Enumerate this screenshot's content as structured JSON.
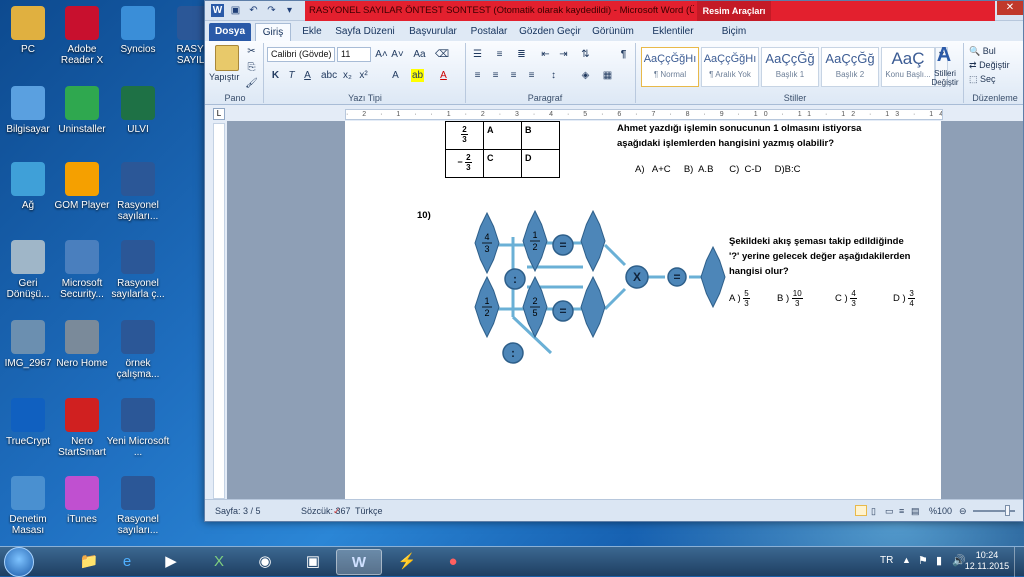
{
  "desktop": {
    "icons": [
      {
        "label": "PC",
        "color": "#e0b040"
      },
      {
        "label": "Adobe Reader X",
        "color": "#c8102e"
      },
      {
        "label": "Syncios",
        "color": "#3a8ed8"
      },
      {
        "label": "RASYO SAYILA",
        "color": "#2b5797"
      },
      {
        "label": "Bilgisayar",
        "color": "#5aa0e0"
      },
      {
        "label": "Uninstaller",
        "color": "#2fa84f"
      },
      {
        "label": "ULVI",
        "color": "#1e7145"
      },
      {
        "label": "Ağ",
        "color": "#3fa0d8"
      },
      {
        "label": "GOM Player",
        "color": "#f5a000"
      },
      {
        "label": "Rasyonel sayıları...",
        "color": "#2b5797"
      },
      {
        "label": "Geri Dönüşü...",
        "color": "#9fb6c8"
      },
      {
        "label": "Microsoft Security...",
        "color": "#4a7fbe"
      },
      {
        "label": "Rasyonel sayılarla ç...",
        "color": "#2b5797"
      },
      {
        "label": "IMG_2967",
        "color": "#6b8fb0"
      },
      {
        "label": "Nero Home",
        "color": "#7a8a9a"
      },
      {
        "label": "örnek çalışma...",
        "color": "#2b5797"
      },
      {
        "label": "TrueCrypt",
        "color": "#1060c0"
      },
      {
        "label": "Nero StartSmart",
        "color": "#d02020"
      },
      {
        "label": "Yeni Microsoft ...",
        "color": "#2b5797"
      },
      {
        "label": "Denetim Masası",
        "color": "#4a90d0"
      },
      {
        "label": "iTunes",
        "color": "#c050d0"
      },
      {
        "label": "Rasyonel sayıları...",
        "color": "#2b5797"
      }
    ]
  },
  "window": {
    "title": "RASYONEL SAYILAR ÖNTEST SONTEST (Otomatik olarak kaydedildi)  -  Microsoft Word (Ürün Et...",
    "context_tab": "Resim Araçları",
    "tabs": [
      "Dosya",
      "Giriş",
      "Ekle",
      "Sayfa Düzeni",
      "Başvurular",
      "Postalar",
      "Gözden Geçir",
      "Görünüm",
      "Eklentiler",
      "Biçim"
    ],
    "active_tab": "Giriş"
  },
  "ribbon": {
    "paste_label": "Yapıştır",
    "clipboard_group": "Pano",
    "font_name": "Calibri (Gövde)",
    "font_size": "11",
    "font_group": "Yazı Tipi",
    "paragraph_group": "Paragraf",
    "styles_group": "Stiller",
    "styles": [
      {
        "preview": "AaÇçĞğHı",
        "name": "¶ Normal"
      },
      {
        "preview": "AaÇçĞğHı",
        "name": "¶ Aralık Yok"
      },
      {
        "preview": "AaÇçĞğ",
        "name": "Başlık 1"
      },
      {
        "preview": "AaÇçĞğ",
        "name": "Başlık 2"
      },
      {
        "preview": "AaÇ",
        "name": "Konu Başlı..."
      }
    ],
    "change_styles": "Stilleri Değiştir",
    "edit_group": "Düzenleme",
    "find": "Bul",
    "replace": "Değiştir",
    "select": "Seç"
  },
  "document": {
    "table": {
      "r1_frac_n": "2",
      "r1_frac_d": "3",
      "r1_a": "A",
      "r1_b": "B",
      "r2_sign": "−",
      "r2_frac_n": "2",
      "r2_frac_d": "3",
      "r2_c": "C",
      "r2_d": "D"
    },
    "q9_line1": "Ahmet yazdığı işlemin sonucunun 1 olmasını istiyorsa",
    "q9_line2": "aşağıdaki işlemlerden hangisini yazmış olabilir?",
    "q9_options": "A)   A+C     B)  A.B      C)  C-D     D)B:C",
    "q10_number": "10)",
    "q10_line1": "Şekildeki akış şeması takip edildiğinde",
    "q10_line2": "'?' yerine gelecek değer aşağıdakilerden",
    "q10_line3": "hangisi olur?",
    "q10_options": [
      {
        "label": "A )",
        "n": "5",
        "d": "3"
      },
      {
        "label": "B )",
        "n": "10",
        "d": "3"
      },
      {
        "label": "C )",
        "n": "4",
        "d": "3"
      },
      {
        "label": "D )",
        "n": "3",
        "d": "4"
      }
    ],
    "flow": {
      "n1": "4",
      "d1": "3",
      "n2": "1",
      "d2": "2",
      "n3": "1",
      "d3": "2",
      "n4": "2",
      "d4": "5",
      "op_div": ":",
      "op_eq": "=",
      "op_mul": "X"
    }
  },
  "status": {
    "page": "Sayfa: 3 / 5",
    "words": "Sözcük: 367",
    "language": "Türkçe",
    "zoom": "%100"
  },
  "taskbar": {
    "lang": "TR",
    "time": "10:24",
    "date": "12.11.2015"
  },
  "colors": {
    "shape_fill": "#4d86b8",
    "shape_stroke": "#2e5f8a",
    "arrow": "#6ab0d6",
    "title_red": "#e3202e"
  }
}
